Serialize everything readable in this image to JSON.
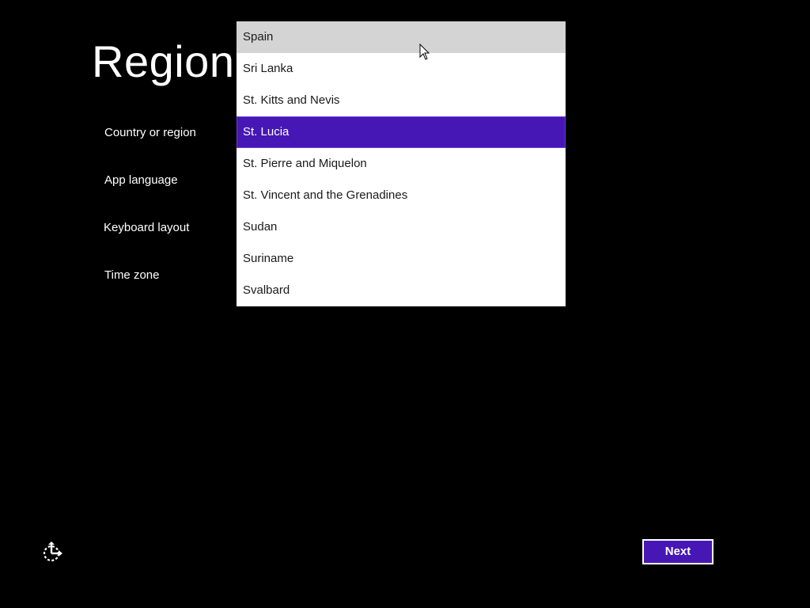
{
  "page": {
    "title": "Region"
  },
  "fields": {
    "country_label": "Country or region",
    "app_language_label": "App language",
    "keyboard_layout_label": "Keyboard layout",
    "time_zone_label": "Time zone"
  },
  "country_dropdown": {
    "hovered_item": "Spain",
    "selected_item": "St. Lucia",
    "items": [
      "Spain",
      "Sri Lanka",
      "St. Kitts and Nevis",
      "St. Lucia",
      "St. Pierre and Miquelon",
      "St. Vincent and the Grenadines",
      "Sudan",
      "Suriname",
      "Svalbard"
    ]
  },
  "footer": {
    "next_label": "Next",
    "ease_of_access_icon": "ease-of-access-icon"
  },
  "colors": {
    "background": "#000000",
    "accent": "#4617b4",
    "list_background": "#ffffff",
    "hover_background": "#d4d4d4"
  }
}
